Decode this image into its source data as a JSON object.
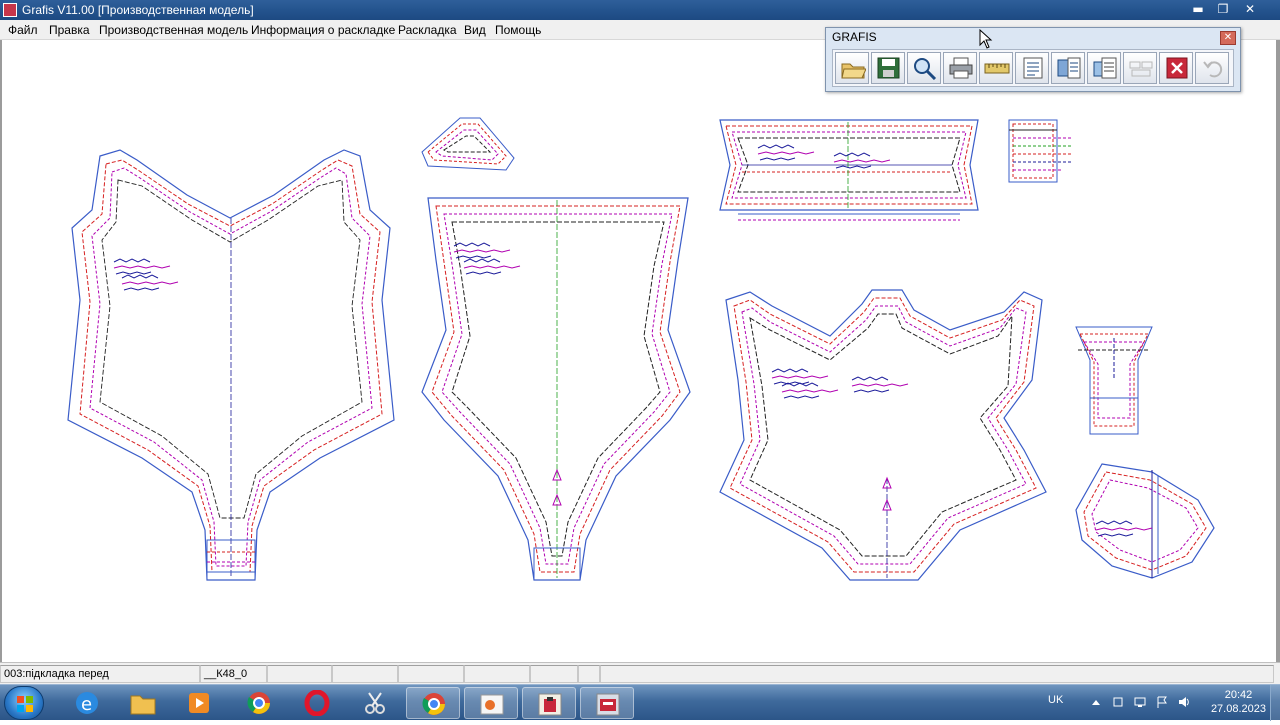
{
  "window": {
    "title": "Grafis V11.00 [Производственная модель]",
    "controls": {
      "minimize": "▬",
      "restore": "❐",
      "close": "✕"
    }
  },
  "menu": {
    "items": [
      {
        "label": "Файл"
      },
      {
        "label": "Правка"
      },
      {
        "label": "Производственная модель"
      },
      {
        "label": "Информация о раскладке"
      },
      {
        "label": "Раскладка"
      },
      {
        "label": "Вид"
      },
      {
        "label": "Помощь"
      }
    ]
  },
  "toolbox": {
    "title": "GRAFIS",
    "close_glyph": "✕",
    "buttons": [
      {
        "icon": "open-folder-icon"
      },
      {
        "icon": "save-icon"
      },
      {
        "icon": "zoom-icon"
      },
      {
        "icon": "print-icon"
      },
      {
        "icon": "ruler-icon"
      },
      {
        "icon": "list-icon"
      },
      {
        "icon": "layout-list-icon"
      },
      {
        "icon": "properties-icon"
      },
      {
        "icon": "disabled-nest-icon"
      },
      {
        "icon": "close-red-icon"
      },
      {
        "icon": "undo-icon"
      }
    ]
  },
  "statusbar": {
    "piece": "003:підкладка перед",
    "size": "__К48_0"
  },
  "taskbar": {
    "apps": [
      {
        "name": "internet-explorer"
      },
      {
        "name": "file-explorer"
      },
      {
        "name": "media-player"
      },
      {
        "name": "chrome"
      },
      {
        "name": "opera"
      },
      {
        "name": "scissors-app"
      },
      {
        "name": "chrome-2"
      },
      {
        "name": "presentation-app"
      },
      {
        "name": "grafis-app-1"
      },
      {
        "name": "grafis-app-2"
      }
    ],
    "tray": {
      "language": "UK",
      "time": "20:42",
      "date": "27.08.2023"
    }
  },
  "colors": {
    "title_bar": "#24548e",
    "outline_blue": "#3a5cc8",
    "seam_red": "#d62020",
    "seam_magenta": "#b000b0",
    "grain_green": "#20a020"
  }
}
